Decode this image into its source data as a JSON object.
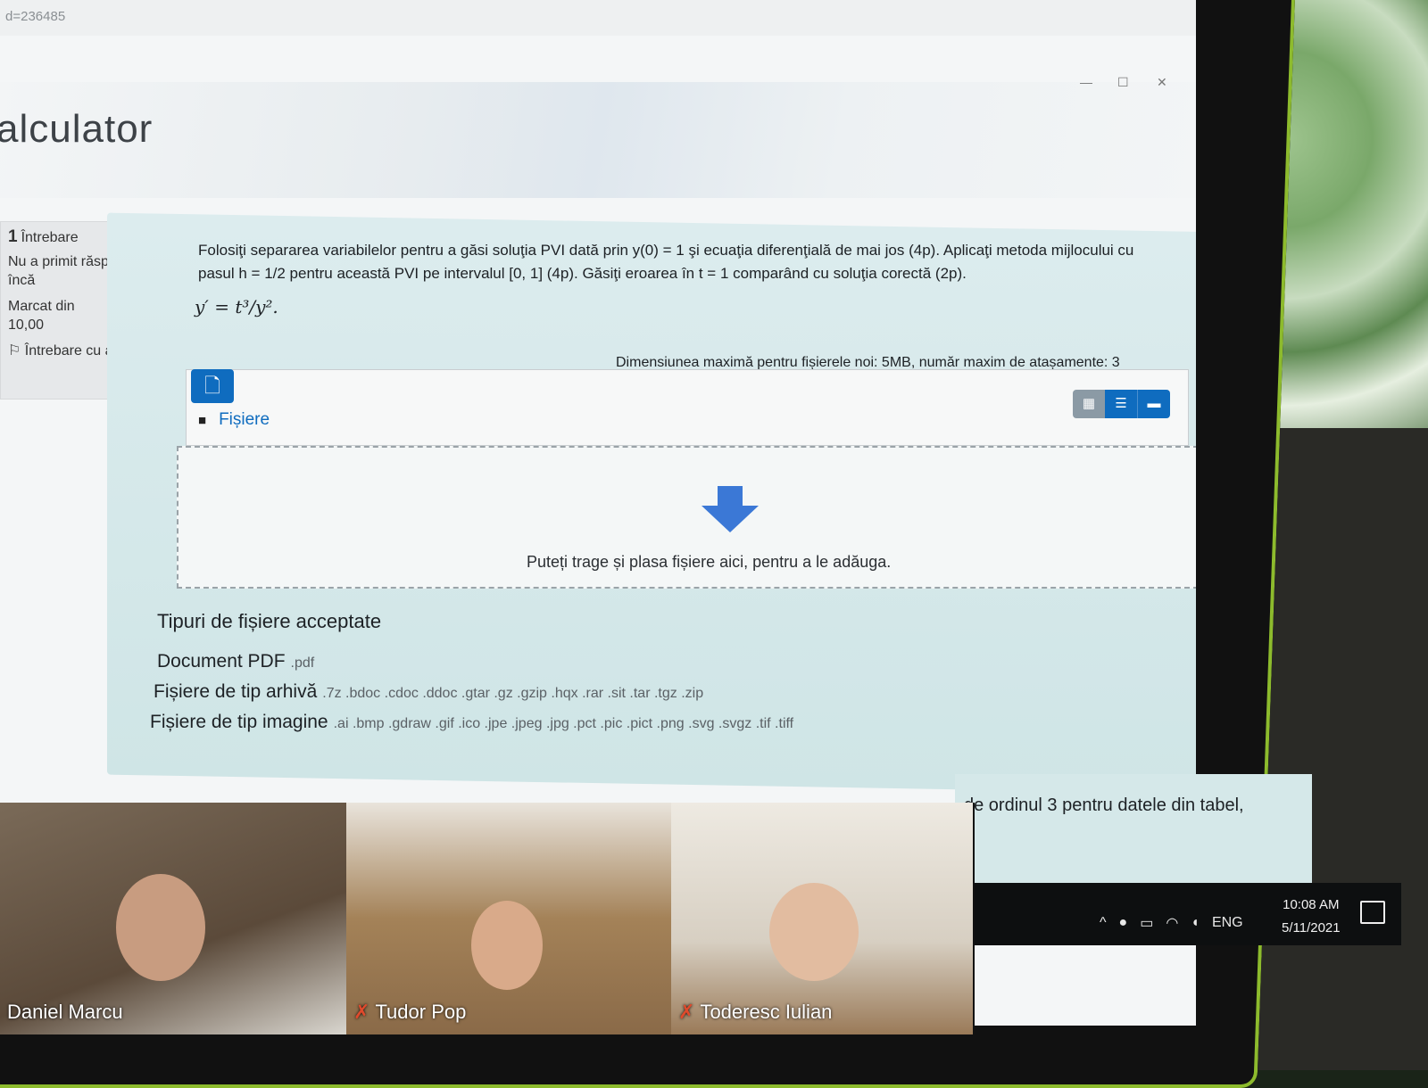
{
  "browser": {
    "url_fragment": "d=236485"
  },
  "header": {
    "title": "alculator"
  },
  "question_info": {
    "number": "1",
    "label": "Întrebare",
    "status": "Nu a primit răspuns încă",
    "marked_label": "Marcat din",
    "marked_value": "10,00",
    "flag_label": "Întrebare cu ag"
  },
  "question": {
    "text": "Folosiţi separarea variabilelor pentru a găsi soluţia PVI dată prin y(0) = 1 şi ecuaţia diferenţială de mai jos (4p). Aplicaţi metoda mijlocului cu pasul h = 1/2 pentru această PVI pe intervalul [0, 1] (4p). Găsiţi eroarea în t = 1 comparând cu soluţia corectă (2p).",
    "equation": "y′ = t³/y²."
  },
  "filepicker": {
    "max_size": "Dimensiunea maximă pentru fișierele noi: 5MB, număr maxim de atașamente: 3",
    "folder_label": "Fișiere",
    "drop_text": "Puteți trage și plasa fișiere aici, pentru a le adăuga."
  },
  "accepted": {
    "title": "Tipuri de fișiere acceptate",
    "types": [
      {
        "label": "Document PDF",
        "ext": ".pdf"
      },
      {
        "label": "Fișiere de tip arhivă",
        "ext": ".7z .bdoc .cdoc .ddoc .gtar .gz .gzip .hqx .rar .sit .tar .tgz .zip"
      },
      {
        "label": "Fișiere de tip imagine",
        "ext": ".ai .bmp .gdraw .gif .ico .jpe .jpeg .jpg .pct .pic .pict .png .svg .svgz .tif .tiff"
      }
    ]
  },
  "next_question": {
    "text": "de ordinul 3 pentru datele din tabel,"
  },
  "video_participants": [
    {
      "name": "Daniel Marcu"
    },
    {
      "name": "Tudor Pop"
    },
    {
      "name": "Toderesc Iulian"
    }
  ],
  "taskbar": {
    "lang": "ENG",
    "time": "10:08 AM",
    "date": "5/11/2021"
  },
  "colors": {
    "accent": "#0f6cbf",
    "question_bg": "#d5e8e9",
    "bezel_green": "#8dbb2d"
  }
}
